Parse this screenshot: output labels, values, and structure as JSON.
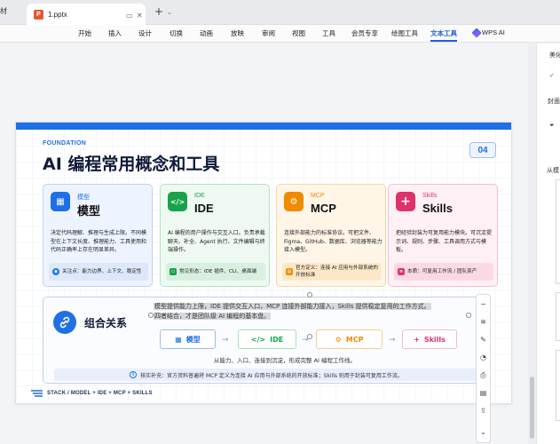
{
  "tabs": {
    "prev_label": "材",
    "active_label": "1.pptx",
    "file_badge": "P",
    "ctrl_window": "▭",
    "ctrl_close": "✕",
    "add_tab": "+",
    "more": "⌄"
  },
  "ribbon": {
    "items": [
      "开始",
      "插入",
      "设计",
      "切换",
      "动画",
      "放映",
      "审阅",
      "视图",
      "工具",
      "会员专享",
      "绘图工具",
      "文本工具",
      "WPS AI"
    ],
    "active": "文本工具"
  },
  "right_panel": {
    "label_1": "美化",
    "label_2": "封面",
    "label_3": "从模"
  },
  "slide": {
    "eyebrow": "FOUNDATION",
    "title": "AI 编程常用概念和工具",
    "page_number": "04",
    "cards": [
      {
        "en": "模型",
        "name": "模型",
        "icon": "▦",
        "desc": "决定代码理解、推理与生成上限。不同模型在上下文长度、推理能力、工具使用和代码正确率上存在明显差异。",
        "note": "关注点：能力边界、上下文、稳定性",
        "accent": "#1f6fe6"
      },
      {
        "en": "IDE",
        "name": "IDE",
        "icon": "</>",
        "desc": "AI 编程的用户操作与交互入口。负责承载聊天、补全、Agent 执行、文件编辑与终端操作。",
        "note": "常见形态：IDE 插件、CLI、桌面端",
        "accent": "#17a34a"
      },
      {
        "en": "MCP",
        "name": "MCP",
        "icon": "⚙",
        "desc": "连接外部能力的标准协议。可把文件、Figma、GitHub、数据库、浏览器等能力接入模型。",
        "note": "官方定义：连接 AI 应用与外部系统的开放标准",
        "accent": "#f08a00"
      },
      {
        "en": "Skills",
        "name": "Skills",
        "icon": "+",
        "desc": "把经验封装为可复用能力模块。可沉淀提示词、规则、步骤、工具调用方式与模板。",
        "note": "本质：可复用工作流 / 团队资产",
        "accent": "#e0316b"
      }
    ],
    "combo": {
      "title": "组合关系",
      "selected_line_1": "模型提供能力上限，IDE 提供交互入口，MCP 连接外部能力接入，Skills 提供稳定复用的工作方式。",
      "selected_line_2": "四者结合，才是团队级 AI 编程的基本盘。",
      "flow": [
        {
          "label": "模型",
          "icon": "▦"
        },
        {
          "label": "IDE",
          "icon": "</>"
        },
        {
          "label": "MCP",
          "icon": "⚙"
        },
        {
          "label": "Skills",
          "icon": "+"
        }
      ],
      "arrow": "→",
      "caption": "从能力、入口、连接到沉淀，形成完整 AI 编程工作线。",
      "note": "核实补充：官方资料普遍将 MCP 定义为连接 AI 应用与外部系统的开放标准；Skills 则用于封装可复用工作流。",
      "info_icon": "i"
    },
    "footer": "STACK / MODEL + IDE + MCP + SKILLS"
  },
  "float_toolbar": {
    "icons": [
      "−",
      "≋",
      "✎",
      "◔",
      "⎙",
      "▤",
      "⇪",
      "⌄"
    ]
  }
}
